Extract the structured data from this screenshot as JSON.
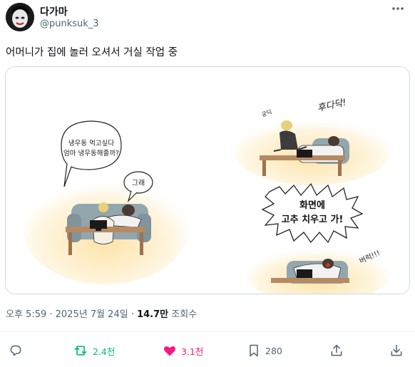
{
  "author": {
    "display_name": "다가마",
    "handle": "@punksuk_3"
  },
  "tweet": {
    "text": "어머니가 집에 놀러 오셔서 거실 작업 중"
  },
  "comic": {
    "bubble_1": [
      "냉우동 먹고싶다",
      "엄마 냉우동해줄까?"
    ],
    "bubble_2": "그래",
    "sfx_1": "후다닥!",
    "sfx_2": "궁딕",
    "bubble_3": [
      "화면에",
      "고추 치우고 가!"
    ],
    "sfx_3": "버럭!!!"
  },
  "meta": {
    "time": "오후 5:59 · 2025년 7월 24일 · ",
    "views": "14.7만",
    "views_label": " 조회수"
  },
  "actions": {
    "reply_count": "",
    "repost_count": "2.4천",
    "like_count": "3.1천",
    "bookmark_count": "280"
  },
  "colors": {
    "repost": "#00ba7c",
    "like": "#f91880",
    "secondary": "#536471"
  }
}
